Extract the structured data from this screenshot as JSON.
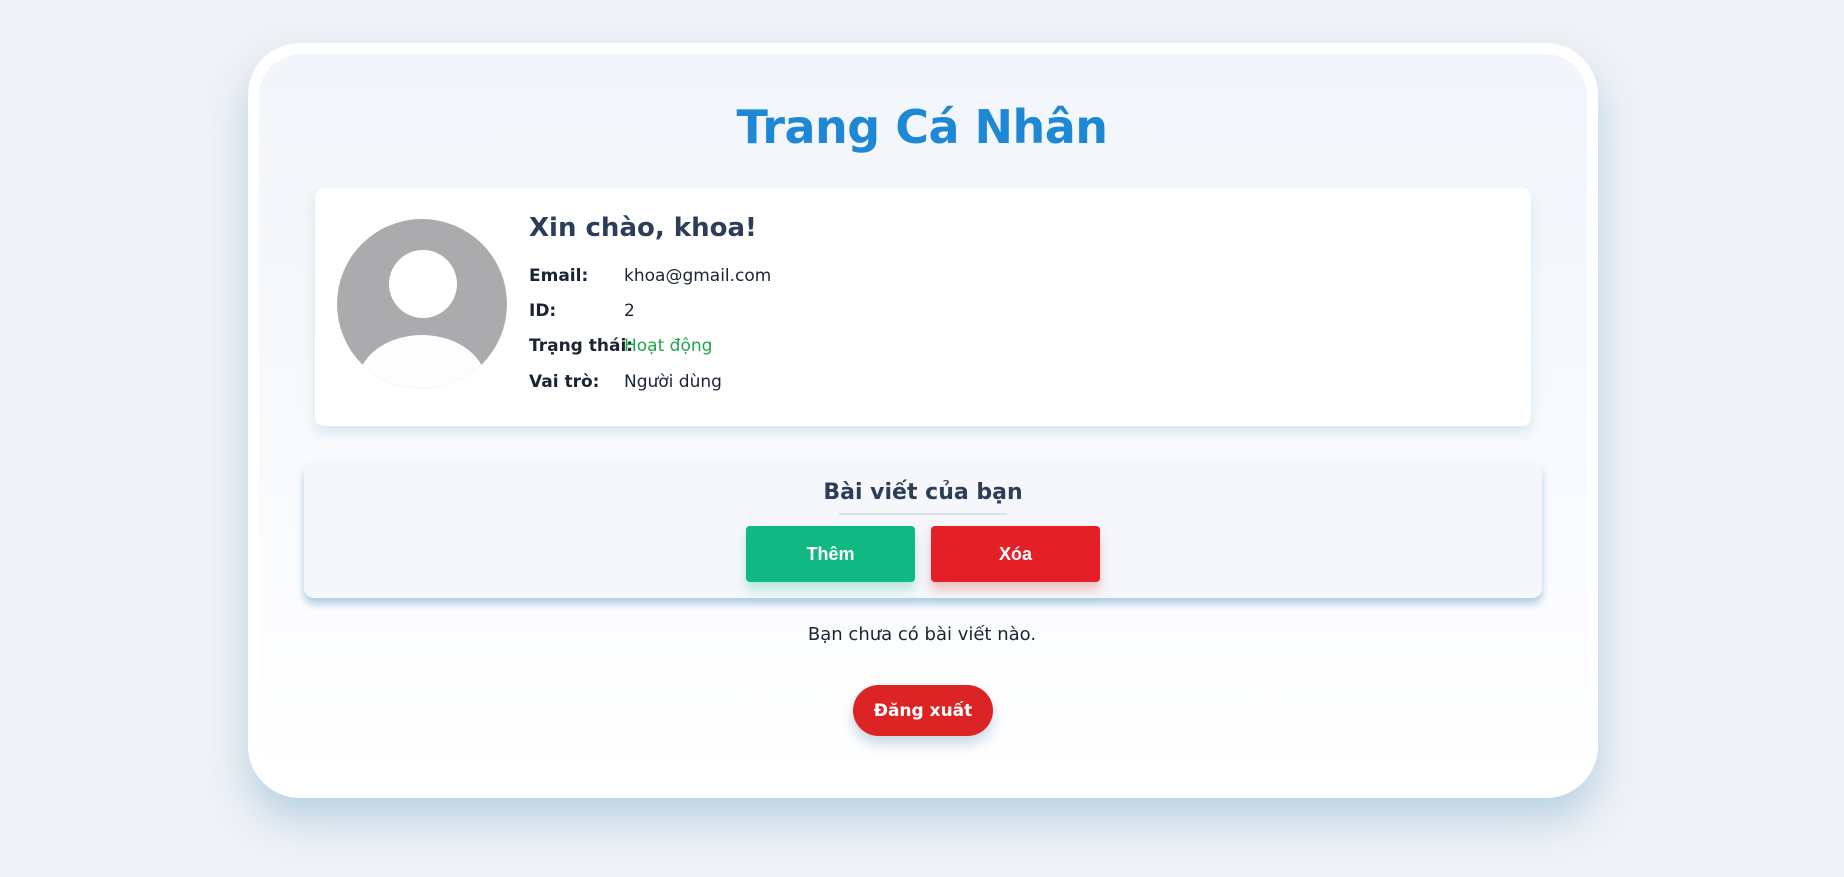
{
  "page": {
    "title": "Trang Cá Nhân"
  },
  "profile": {
    "avatar_icon": "user-avatar-placeholder",
    "greeting": "Xin chào, khoa!",
    "fields": [
      {
        "label": "Email:",
        "value": "khoa@gmail.com"
      },
      {
        "label": "ID:",
        "value": "2"
      },
      {
        "label": "Trạng thái:",
        "value": "Hoạt động",
        "value_color": "#1fa64a"
      },
      {
        "label": "Vai trò:",
        "value": "Người dùng"
      }
    ]
  },
  "posts": {
    "title": "Bài viết của bạn",
    "add_label": "Thêm",
    "delete_label": "Xóa",
    "empty_message": "Bạn chưa có bài viết nào."
  },
  "logout_label": "Đăng xuất",
  "colors": {
    "title": "#1e88d4",
    "add_button": "#10b981",
    "delete_button": "#e41f25",
    "logout_button": "#dc2424",
    "status_active": "#1fa64a"
  }
}
